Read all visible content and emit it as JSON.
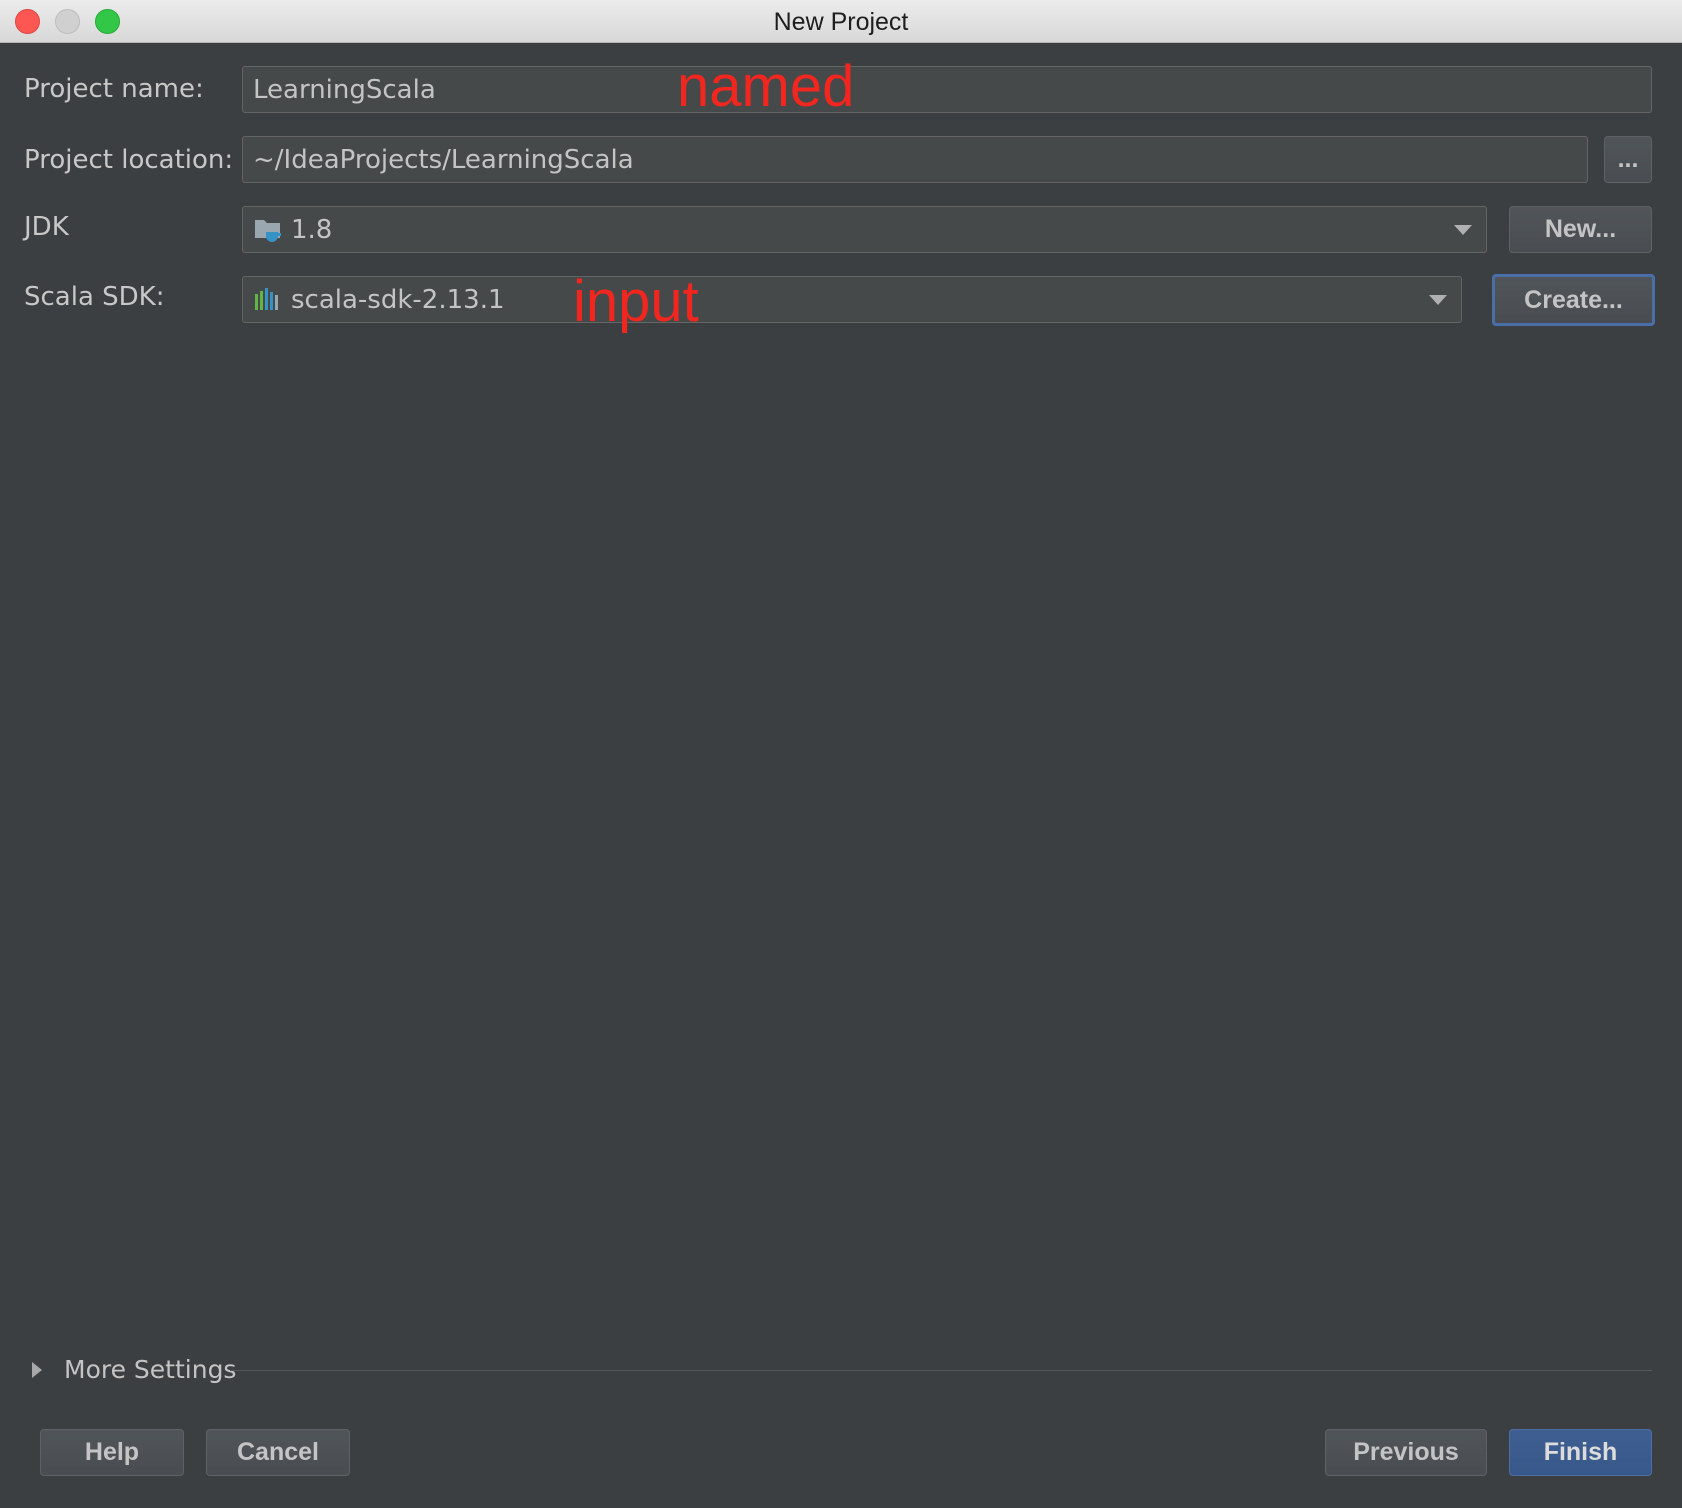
{
  "window": {
    "title": "New Project"
  },
  "form": {
    "project_name": {
      "label": "Project name:",
      "value": "LearningScala"
    },
    "project_location": {
      "label": "Project location:",
      "value": "~/IdeaProjects/LearningScala",
      "browse_label": "..."
    },
    "jdk": {
      "label": "JDK",
      "value": "1.8",
      "icon": "jdk-folder-icon",
      "new_label": "New..."
    },
    "scala_sdk": {
      "label": "Scala SDK:",
      "value": "scala-sdk-2.13.1",
      "icon": "library-icon",
      "create_label": "Create..."
    }
  },
  "annotations": {
    "name_note": "named",
    "sdk_note": "input",
    "color": "#f0261f"
  },
  "more_settings": {
    "label": "More Settings"
  },
  "footer": {
    "help": "Help",
    "cancel": "Cancel",
    "previous": "Previous",
    "finish": "Finish"
  },
  "colors": {
    "background": "#3c3f41",
    "field": "#45494a",
    "primary_button": "#3f5f93",
    "focus_ring": "#4a6ea8"
  }
}
